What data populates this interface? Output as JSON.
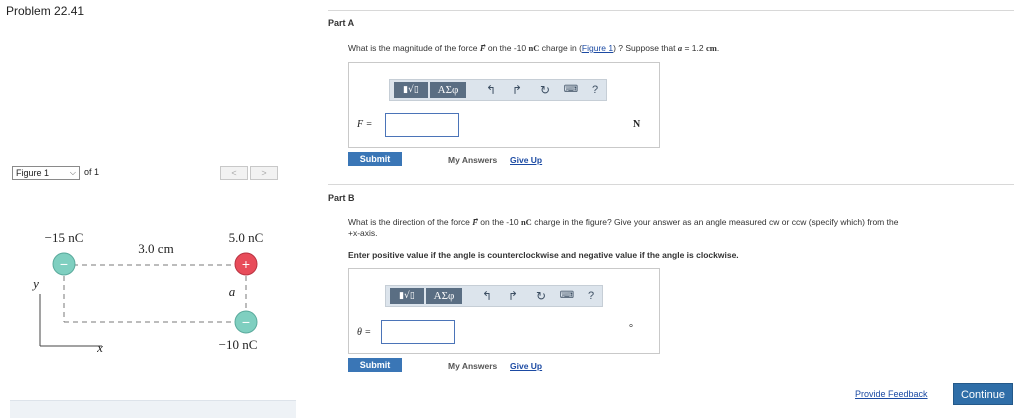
{
  "problem": {
    "title": "Problem 22.41"
  },
  "figure_nav": {
    "selected": "Figure 1",
    "of_text": "of 1",
    "prev": "<",
    "next": ">"
  },
  "figure": {
    "charge_left": "−15 nC",
    "charge_top_right": "5.0 nC",
    "charge_bottom_right": "−10 nC",
    "distance": "3.0 cm",
    "side": "a",
    "axis_y": "y",
    "axis_x": "x",
    "plus_sign": "+",
    "minus_sign": "−",
    "colors": {
      "negative": "#7fcfc0",
      "positive": "#e84c5a",
      "dash": "#7a7a7a"
    }
  },
  "partA": {
    "title": "Part A",
    "question_prefix": "What is the magnitude of the force ",
    "force_symbol": "F",
    "question_mid": " on the -10 ",
    "unit_nc": "nC",
    "question_mid2": " charge in (",
    "figure_link": "Figure 1",
    "question_mid3": ") ? Suppose that ",
    "var_a": "a",
    "question_eq": " = 1.2 ",
    "unit_cm": "cm",
    "question_end": ".",
    "answer_label": "F =",
    "answer_value": "",
    "answer_unit": "N"
  },
  "partB": {
    "title": "Part B",
    "question_line1_prefix": "What is the direction of the force ",
    "force_symbol": "F",
    "question_line1_mid": " on the -10 ",
    "unit_nc": "nC",
    "question_line1_end": " charge in the figure? Give your answer as an angle measured cw or ccw (specify which) from the",
    "question_line2": "+x-axis.",
    "instruction": "Enter positive value if the angle is counterclockwise and negative value if the angle is clockwise.",
    "answer_label": "θ =",
    "answer_value": "",
    "answer_unit": "°"
  },
  "toolbar": {
    "frac_label": "▮√▯",
    "greek_label": "ΑΣφ",
    "undo": "↰",
    "redo": "↱",
    "reset": "↻",
    "keyboard": "⌨",
    "help": "?"
  },
  "actions": {
    "submit": "Submit",
    "my_answers": "My Answers",
    "give_up": "Give Up",
    "provide_feedback": "Provide Feedback",
    "continue": "Continue"
  }
}
